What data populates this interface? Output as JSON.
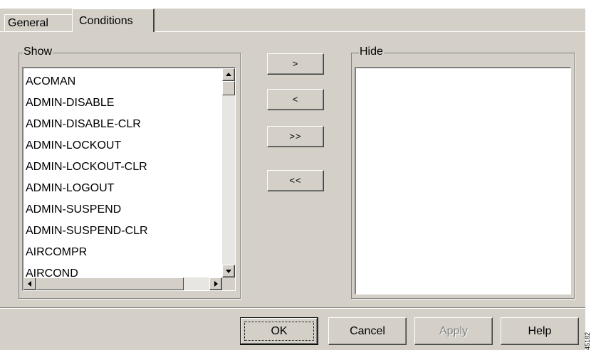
{
  "tabs": [
    {
      "label": "General",
      "active": false
    },
    {
      "label": "Conditions",
      "active": true
    }
  ],
  "show_panel": {
    "legend": "Show",
    "items": [
      "ACOMAN",
      "ADMIN-DISABLE",
      "ADMIN-DISABLE-CLR",
      "ADMIN-LOCKOUT",
      "ADMIN-LOCKOUT-CLR",
      "ADMIN-LOGOUT",
      "ADMIN-SUSPEND",
      "ADMIN-SUSPEND-CLR",
      "AIRCOMPR",
      "AIRCOND"
    ]
  },
  "hide_panel": {
    "legend": "Hide",
    "items": []
  },
  "move_buttons": {
    "move_right": ">",
    "move_left": "<",
    "move_all_right": ">>",
    "move_all_left": "<<"
  },
  "dialog_buttons": {
    "ok": "OK",
    "cancel": "Cancel",
    "apply": "Apply",
    "help": "Help",
    "apply_enabled": false
  },
  "icons": {
    "scroll_up": "arrow-up-icon",
    "scroll_down": "arrow-down-icon",
    "scroll_left": "arrow-left-icon",
    "scroll_right": "arrow-right-icon"
  },
  "colors": {
    "dialog_face": "#d4d0c8",
    "list_background": "#ffffff",
    "disabled_text": "#808080"
  },
  "edge_text": "45182"
}
